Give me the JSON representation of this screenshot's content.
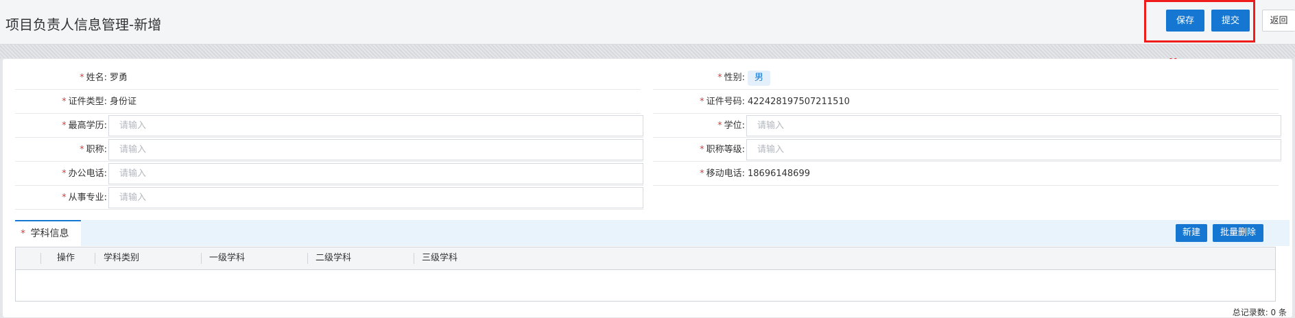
{
  "header": {
    "title": "项目负责人信息管理-新增",
    "save_label": "保存",
    "submit_label": "提交",
    "back_label": "返回"
  },
  "form": {
    "left": [
      {
        "label": "姓名:",
        "value": "罗勇",
        "type": "text"
      },
      {
        "label": "证件类型:",
        "value": "身份证",
        "type": "text"
      },
      {
        "label": "最高学历:",
        "placeholder": "请输入",
        "type": "input"
      },
      {
        "label": "职称:",
        "placeholder": "请输入",
        "type": "input"
      },
      {
        "label": "办公电话:",
        "placeholder": "请输入",
        "type": "input"
      },
      {
        "label": "从事专业:",
        "placeholder": "请输入",
        "type": "input"
      }
    ],
    "right": [
      {
        "label": "性别:",
        "value": "男",
        "type": "tag"
      },
      {
        "label": "证件号码:",
        "value": "422428197507211510",
        "type": "text"
      },
      {
        "label": "学位:",
        "placeholder": "请输入",
        "type": "input"
      },
      {
        "label": "职称等级:",
        "placeholder": "请输入",
        "type": "input"
      },
      {
        "label": "移动电话:",
        "value": "18696148699",
        "type": "text"
      }
    ],
    "required_mark": "*"
  },
  "subject": {
    "tab_label": "学科信息",
    "new_label": "新建",
    "batch_delete_label": "批量删除",
    "columns": [
      "操作",
      "学科类别",
      "一级学科",
      "二级学科",
      "三级学科"
    ],
    "rows": [],
    "total_text": "总记录数: 0 条"
  },
  "colors": {
    "primary": "#1677d2",
    "required": "#e23b3b",
    "highlight": "#ef1c1c"
  }
}
